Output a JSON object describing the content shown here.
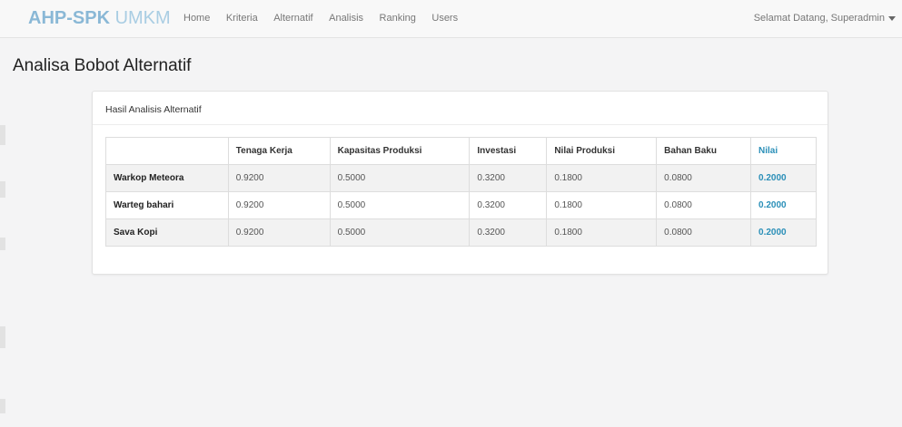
{
  "navbar": {
    "brand_strong": "AHP-SPK",
    "brand_light": "UMKM",
    "links": [
      "Home",
      "Kriteria",
      "Alternatif",
      "Analisis",
      "Ranking",
      "Users"
    ],
    "user_greeting": "Selamat Datang, Superadmin"
  },
  "page": {
    "title": "Analisa Bobot Alternatif"
  },
  "panel": {
    "heading": "Hasil Analisis Alternatif"
  },
  "table": {
    "headers": [
      "",
      "Tenaga Kerja",
      "Kapasitas Produksi",
      "Investasi",
      "Nilai Produksi",
      "Bahan Baku",
      "Nilai"
    ],
    "rows": [
      [
        "Warkop Meteora",
        "0.9200",
        "0.5000",
        "0.3200",
        "0.1800",
        "0.0800",
        "0.2000"
      ],
      [
        "Warteg bahari",
        "0.9200",
        "0.5000",
        "0.3200",
        "0.1800",
        "0.0800",
        "0.2000"
      ],
      [
        "Sava Kopi",
        "0.9200",
        "0.5000",
        "0.3200",
        "0.1800",
        "0.0800",
        "0.2000"
      ]
    ]
  },
  "colors": {
    "accent": "#2a8fb8",
    "brand": "#8ab8d6",
    "background": "#f4f4f5"
  }
}
